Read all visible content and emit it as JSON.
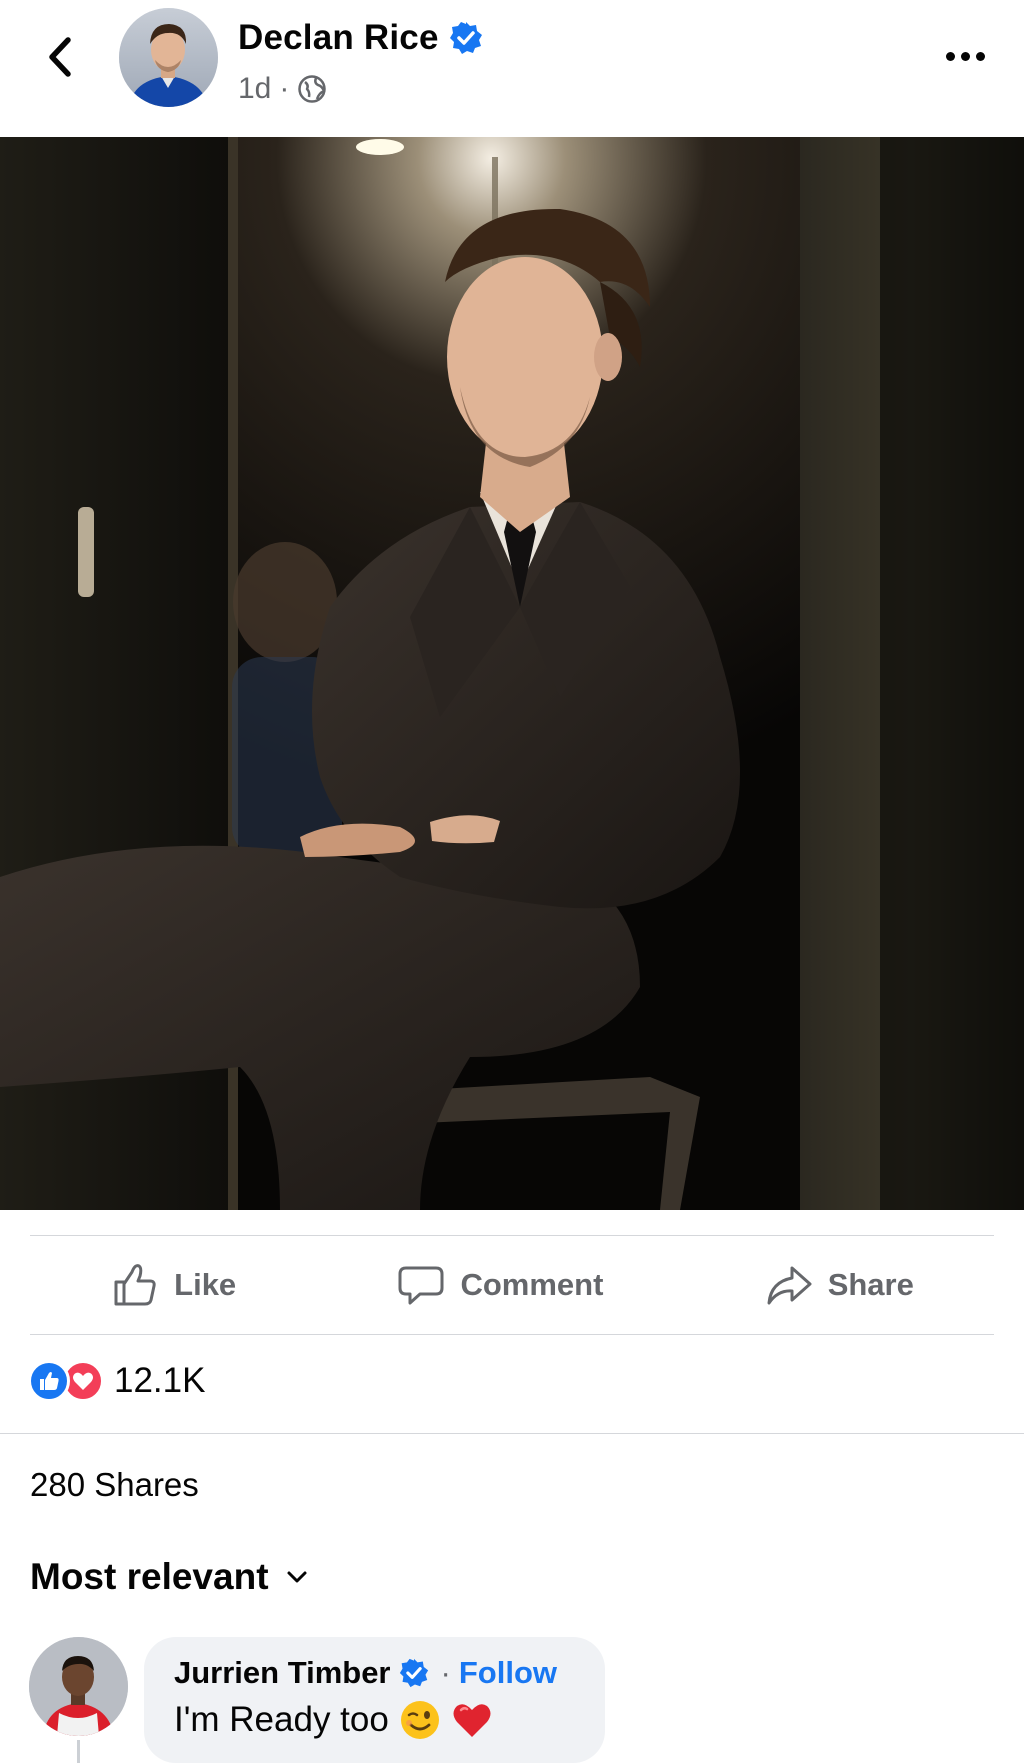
{
  "post": {
    "author": "Declan Rice",
    "time": "1d",
    "separator": "·",
    "audience_icon": "globe-icon",
    "verified_icon": "verified-badge-icon"
  },
  "actions": {
    "like": "Like",
    "comment": "Comment",
    "share": "Share"
  },
  "reactions": {
    "count": "12.1K",
    "types": [
      "like",
      "love"
    ]
  },
  "shares": "280 Shares",
  "sort": {
    "label": "Most relevant"
  },
  "comments": [
    {
      "name": "Jurrien Timber",
      "separator": "·",
      "follow": "Follow",
      "text": "I'm Ready too",
      "emojis": [
        "winking-face",
        "red-heart"
      ]
    }
  ],
  "colors": {
    "accent": "#1877f2",
    "love": "#f33e58",
    "secondary_text": "#65676b"
  }
}
